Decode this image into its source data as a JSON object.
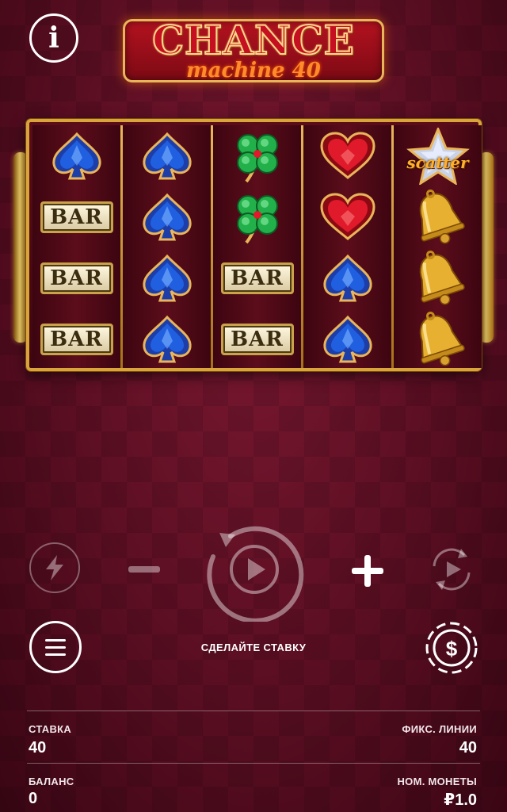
{
  "header": {
    "info_icon": "info-icon",
    "info_glyph": "i",
    "logo_title": "CHANCE",
    "logo_subtitle": "machine 40"
  },
  "reels": [
    [
      "spade",
      "bar",
      "bar",
      "bar"
    ],
    [
      "spade",
      "spade",
      "spade",
      "spade"
    ],
    [
      "clover",
      "clover",
      "bar",
      "bar"
    ],
    [
      "heart",
      "heart",
      "spade",
      "spade"
    ],
    [
      "scatter",
      "bell",
      "bell",
      "bell"
    ]
  ],
  "symbols": {
    "bar_text": "BAR",
    "scatter_text": "scatter"
  },
  "controls": {
    "turbo_icon": "lightning-icon",
    "minus_icon": "minus-icon",
    "spin_icon": "spin-play-icon",
    "plus_icon": "plus-icon",
    "autoplay_icon": "autoplay-icon",
    "menu_icon": "menu-icon",
    "bet_icon": "dollar-chip-icon",
    "prompt": "СДЕЛАЙТЕ СТАВКУ"
  },
  "stats": {
    "stake_label": "СТАВКА",
    "stake_value": "40",
    "lines_label": "ФИКС. ЛИНИИ",
    "lines_value": "40",
    "balance_label": "БАЛАНС",
    "balance_value": "0",
    "coin_label": "НОМ. МОНЕТЫ",
    "coin_value": "₽1.0"
  },
  "colors": {
    "background": "#5a0e22",
    "frame_gold": "#d9a43a",
    "spade_blue": "#1f5fe0",
    "heart_red": "#e01a2a",
    "clover_green": "#22b04a",
    "bell_gold": "#e8b030"
  }
}
